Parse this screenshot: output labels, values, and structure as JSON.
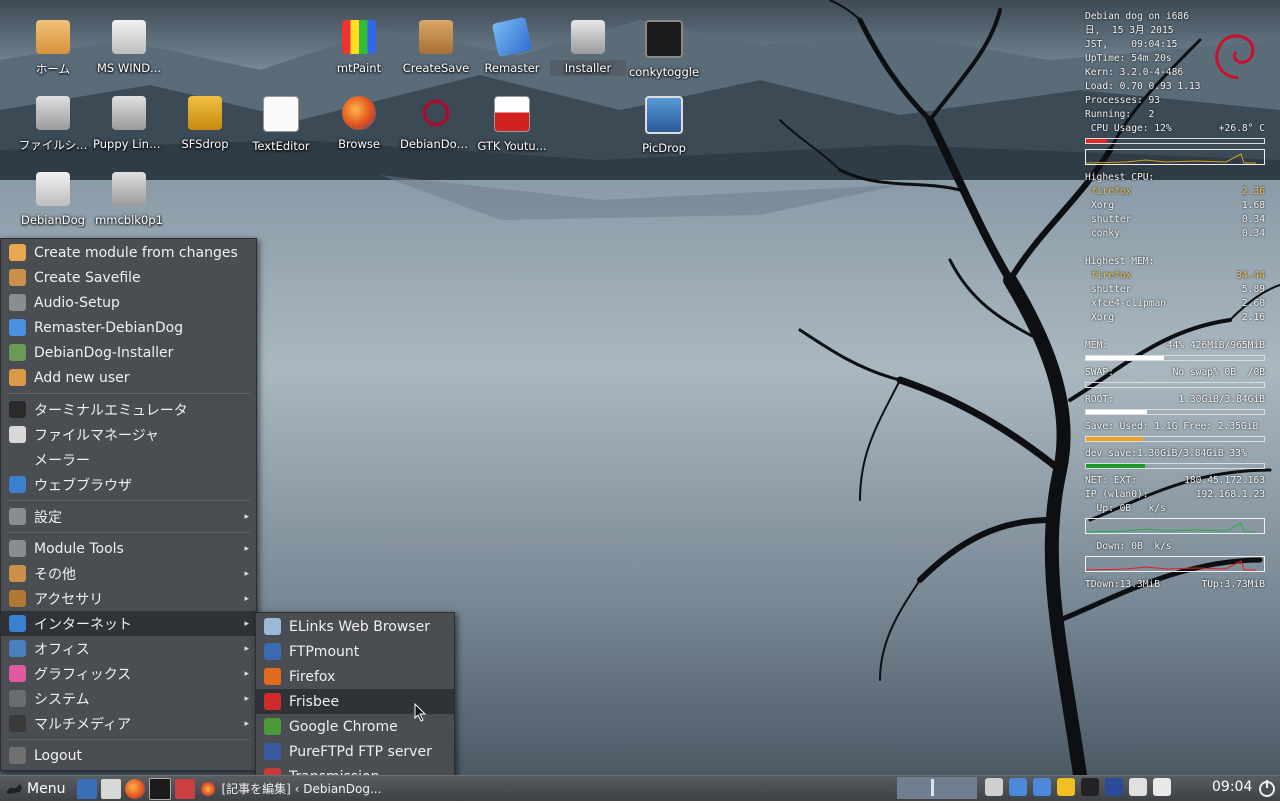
{
  "desktop_icons": [
    {
      "label": "ホーム",
      "icon": "folder-home-icon"
    },
    {
      "label": "MS WIND...",
      "icon": "usb-drive-icon"
    },
    {
      "label": "mtPaint",
      "icon": "pencils-icon"
    },
    {
      "label": "CreateSave",
      "icon": "package-icon"
    },
    {
      "label": "Remaster",
      "icon": "disc-icon"
    },
    {
      "label": "Installer",
      "icon": "installer-icon"
    },
    {
      "label": "conkytoggle",
      "icon": "monitor-graph-icon"
    },
    {
      "label": "ファイルシ...",
      "icon": "drive-icon"
    },
    {
      "label": "Puppy Linu...",
      "icon": "drive-icon"
    },
    {
      "label": "SFSdrop",
      "icon": "sfs-bag-icon"
    },
    {
      "label": "TextEditor",
      "icon": "notepad-icon"
    },
    {
      "label": "Browse",
      "icon": "firefox-icon"
    },
    {
      "label": "DebianDog...",
      "icon": "debian-swirl-icon"
    },
    {
      "label": "GTK Youtu...",
      "icon": "youtube-icon"
    },
    {
      "label": "PicDrop",
      "icon": "screen-picture-icon"
    },
    {
      "label": "DebianDog",
      "icon": "usb-drive-icon"
    },
    {
      "label": "mmcblk0p1",
      "icon": "drive-icon"
    }
  ],
  "conky": {
    "header": [
      "Debian dog on i686",
      "日,  15 3月 2015",
      "JST,    09:04:15",
      "UpTime: 54m 20s",
      "Kern: 3.2.0-4-486",
      "Load: 0.70 0.93 1.13",
      "Processes: 93",
      "Running:   2"
    ],
    "cpu_usage_label": " CPU Usage: 12%",
    "cpu_temp": "+26.8° C",
    "cpu_usage_fraction": 0.12,
    "highest_cpu_label": "Highest CPU:",
    "highest_cpu": [
      [
        "firefox",
        "2.36"
      ],
      [
        "Xorg",
        "1.68"
      ],
      [
        "shutter",
        "0.34"
      ],
      [
        "conky",
        "0.34"
      ]
    ],
    "highest_mem_label": "Highest MEM:",
    "highest_mem": [
      [
        "firefox",
        "34.44"
      ],
      [
        "shutter",
        "5.89"
      ],
      [
        "xfce4-clipman",
        "2.60"
      ],
      [
        "Xorg",
        "2.16"
      ]
    ],
    "mem_label": "MEM:",
    "mem_value": "44% 426MiB/965MiB",
    "mem_fraction": 0.44,
    "swap_label": "SWAP:",
    "swap_value": "No swap% 0B  /0B",
    "swap_fraction": 0,
    "root_label": "ROOT:",
    "root_value": "1.30GiB/3.84GiB",
    "root_fraction": 0.34,
    "save_label": "Save: Used: 1.1G Free: 2.35GiB",
    "save_fraction": 0.32,
    "dev_save_label": "dev_save:1.30GiB/3.84GiB 33%",
    "dev_save_fraction": 0.33,
    "net_ext_label": "NET: EXT:",
    "net_ext_value": "180.45.172.163",
    "ip_label": "IP (wlan0):",
    "ip_value": "192.168.1.23",
    "up_label": "  Up: 0B   k/s",
    "down_label": "  Down: 0B  k/s",
    "tdown": "TDown:13.3MiB",
    "tup": "TUp:3.73MiB",
    "colors": {
      "cpu_bar": "#e02828",
      "save_bar": "#f0a020",
      "dev_bar": "#1e9a2a",
      "mem_bar": "#ffffff"
    }
  },
  "main_menu": {
    "items": [
      {
        "label": "Create module from changes",
        "icon": "folder-icon",
        "color": "#e7a850"
      },
      {
        "label": "Create Savefile",
        "icon": "package-icon",
        "color": "#c89048"
      },
      {
        "label": "Audio-Setup",
        "icon": "sliders-icon",
        "color": "#8a8d90"
      },
      {
        "label": "Remaster-DebianDog",
        "icon": "disc-icon",
        "color": "#4a90e0"
      },
      {
        "label": "DebianDog-Installer",
        "icon": "installer-icon",
        "color": "#6a9a5a"
      },
      {
        "label": "Add new user",
        "icon": "folder-icon",
        "color": "#d99a48"
      },
      {
        "sep": true
      },
      {
        "label": "ターミナルエミュレータ",
        "icon": "terminal-icon",
        "color": "#2a2a2a"
      },
      {
        "label": "ファイルマネージャ",
        "icon": "file-manager-icon",
        "color": "#d8d8d8"
      },
      {
        "label": "メーラー",
        "icon": "",
        "color": ""
      },
      {
        "label": "ウェブブラウザ",
        "icon": "compass-icon",
        "color": "#3a7fd0"
      },
      {
        "sep": true
      },
      {
        "label": "設定",
        "icon": "settings-icon",
        "color": "#8a8d90",
        "sub": true
      },
      {
        "sep": true
      },
      {
        "label": "Module Tools",
        "icon": "gear-icon",
        "color": "#8a8d90",
        "sub": true
      },
      {
        "label": "その他",
        "icon": "package-icon",
        "color": "#c89048",
        "sub": true
      },
      {
        "label": "アクセサリ",
        "icon": "tools-icon",
        "color": "#b07830",
        "sub": true
      },
      {
        "label": "インターネット",
        "icon": "globe-icon",
        "color": "#3a7fd0",
        "sub": true,
        "active": true
      },
      {
        "label": "オフィス",
        "icon": "office-icon",
        "color": "#4a80c0",
        "sub": true
      },
      {
        "label": "グラフィックス",
        "icon": "palette-icon",
        "color": "#e05aa0",
        "sub": true
      },
      {
        "label": "システム",
        "icon": "system-icon",
        "color": "#6a6d70",
        "sub": true
      },
      {
        "label": "マルチメディア",
        "icon": "film-icon",
        "color": "#3a3a3a",
        "sub": true
      },
      {
        "sep": true
      },
      {
        "label": "Logout",
        "icon": "power-icon",
        "color": "#707070"
      }
    ]
  },
  "internet_submenu": {
    "items": [
      {
        "label": "ELinks Web Browser",
        "icon": "elinks-icon",
        "color": "#9ab8d8"
      },
      {
        "label": "FTPmount",
        "icon": "network-drive-icon",
        "color": "#3a6ab0"
      },
      {
        "label": "Firefox",
        "icon": "firefox-icon",
        "color": "#e06a1e"
      },
      {
        "label": "Frisbee",
        "icon": "frisbee-icon",
        "color": "#d02a2a",
        "active": true
      },
      {
        "label": "Google Chrome",
        "icon": "chrome-icon",
        "color": "#4a9a3a"
      },
      {
        "label": "PureFTPd FTP server",
        "icon": "ftp-server-icon",
        "color": "#3a5aa0"
      },
      {
        "label": "Transmission",
        "icon": "transmission-icon",
        "color": "#c83a3a"
      }
    ]
  },
  "taskbar": {
    "menu_label": "Menu",
    "window_title": "[記事を編集] ‹ DebianDog...",
    "clock": "09:04",
    "tray_icons": [
      "clipboard-icon",
      "network-icon",
      "bluetooth-icon",
      "crown-icon",
      "dog-icon",
      "r-icon",
      "keyboard-icon",
      "volume-icon"
    ]
  }
}
